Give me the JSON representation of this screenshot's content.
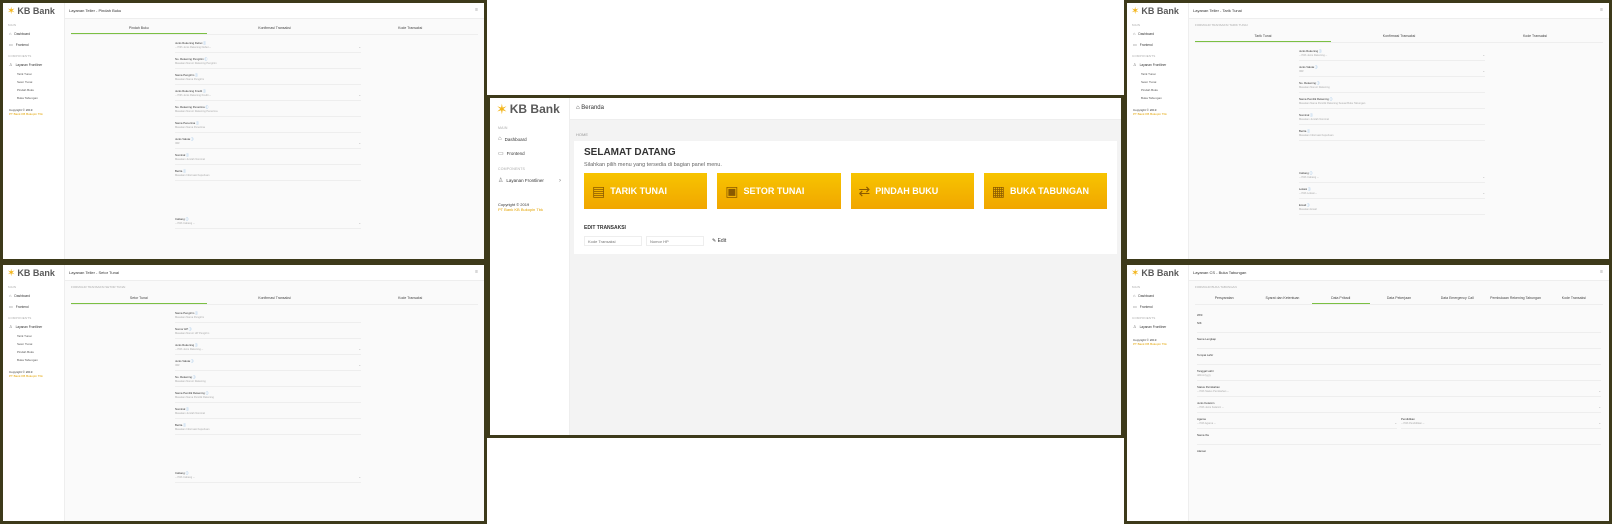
{
  "brand": "KB Bank",
  "sidebar": {
    "main_label": "MAIN",
    "dashboard": "Dashboard",
    "frontend": "Frontend",
    "components_label": "COMPONENTS",
    "layanan": "Layanan Frontliner",
    "sub_tarik": "Tarik Tunai",
    "sub_setor": "Setor Tunai",
    "sub_pindah": "Pindah Buku",
    "sub_buka": "Buka Tabungan",
    "copyright": "Copyright © 2019",
    "company": "PT Bank KB Bukopin Tbk"
  },
  "main": {
    "topbar": "Beranda",
    "crumb": "HOME",
    "welcome_title": "SELAMAT DATANG",
    "welcome_sub": "Silahkan pilih menu yang tersedia di bagian panel menu.",
    "menu": [
      "TARIK TUNAI",
      "SETOR TUNAI",
      "PINDAH BUKU",
      "BUKA TABUNGAN"
    ],
    "edit_title": "EDIT TRANSAKSI",
    "kode_placeholder": "Kode Transaksi",
    "nomor_placeholder": "Nomor HP",
    "edit_btn": "Edit"
  },
  "pindah": {
    "title": "Layanan Teller - Pindah Buku",
    "tabs": [
      "Pindah Buku",
      "Konfirmasi Transaksi",
      "Kode Transaksi"
    ],
    "fields": [
      {
        "label": "Jenis Rekening Debet",
        "ph": "-- PIlih Jenis Rekening Debet --",
        "dd": true
      },
      {
        "label": "No. Rekening Pengirim",
        "ph": "Masukan Nomor Rekening Pengirim"
      },
      {
        "label": "Nama Pengirim",
        "ph": "Masukan Nama Pengirim"
      },
      {
        "label": "Jenis Rekening Kredit",
        "ph": "-- PIlih Jenis Rekening Kredit --",
        "dd": true
      },
      {
        "label": "No. Rekening Penerima",
        "ph": "Masukan Nomor Rekening Penerima"
      },
      {
        "label": "Nama Penerima",
        "ph": "Masukan Nama Penerima"
      },
      {
        "label": "Jenis Valuta",
        "ph": "IDR",
        "dd": true
      },
      {
        "label": "Nominal",
        "ph": "Masukan Jumlah Nominal"
      },
      {
        "label": "Berita",
        "ph": "Masukan Informasi Keperluan"
      }
    ],
    "cabang_label": "Cabang",
    "cabang_ph": "-- Pilih Cabang --"
  },
  "setor": {
    "title": "Layanan Teller - Setor Tunai",
    "panel": "FORMULIR TRANSAKSI SETOR TUNAI",
    "tabs": [
      "Setor Tunai",
      "Konfirmasi Transaksi",
      "Kode Transaksi"
    ],
    "fields": [
      {
        "label": "Nama Pengirim",
        "ph": "Masukan Nama Pengirim"
      },
      {
        "label": "Nomor HP",
        "ph": "Masukan Nomor HP Pengirim"
      },
      {
        "label": "Jenis Rekening",
        "ph": "-- Pilih Jenis Rekening --",
        "dd": true
      },
      {
        "label": "Jenis Valuta",
        "ph": "IDR",
        "dd": true
      },
      {
        "label": "No. Rekening",
        "ph": "Masukan Nomor Rekening"
      },
      {
        "label": "Nama Pemilik Rekening",
        "ph": "Masukan Nama Pemilik Rekening"
      },
      {
        "label": "Nominal",
        "ph": "Masukan Jumlah Nominal"
      },
      {
        "label": "Berita",
        "ph": "Masukan Informasi Keperluan"
      }
    ],
    "cabang_label": "Cabang",
    "cabang_ph": "-- Pilih Cabang --"
  },
  "tarik": {
    "title": "Layanan Teller - Tarik Tunai",
    "panel": "FORMULIR TRANSAKSI TARIK TUNAI",
    "tabs": [
      "Tarik Tunai",
      "Konfirmasi Transaksi",
      "Kode Transaksi"
    ],
    "fields": [
      {
        "label": "Jenis Rekening",
        "ph": "-- Pilih Jenis Rekening --",
        "dd": true
      },
      {
        "label": "Jenis Valuta",
        "ph": "IDR",
        "dd": true
      },
      {
        "label": "No. Rekening",
        "ph": "Masukan Nomor Rekening"
      },
      {
        "label": "Nama Pemilik Rekening",
        "ph": "Masukan Nama Pemilik Rekening Sesuai Buku Tabungan"
      },
      {
        "label": "Nominal",
        "ph": "Masukan Jumlah Nominal"
      },
      {
        "label": "Berita",
        "ph": "Masukan Informasi Keperluan"
      }
    ],
    "extra": [
      {
        "label": "Cabang",
        "ph": "-- Pilih Cabang --",
        "dd": true
      },
      {
        "label": "Lokasi",
        "ph": "-- Pilih Lokasi --",
        "dd": true
      },
      {
        "label": "Email",
        "ph": "Masukan Email"
      }
    ]
  },
  "buka": {
    "title": "Layanan CS - Buka Tabungan",
    "panel": "FORMULIR BUKA TABUNGAN",
    "tabs": [
      "Persyaratan",
      "Syarat dan Ketentuan",
      "Data Pribadi",
      "Data Pekerjaan",
      "Data Emergency Call",
      "Pembukaan Rekening Tabungan",
      "Kode Transaksi"
    ],
    "section": "WNI",
    "fields": [
      {
        "label": "NIK",
        "ph": ""
      },
      {
        "label": "Nama Lengkap",
        "ph": ""
      },
      {
        "label": "Tempat Lahir",
        "ph": ""
      },
      {
        "label": "Tanggal Lahir",
        "ph": "dd/mm/yyyy"
      },
      {
        "label": "Status Pernikahan",
        "ph": "-- Pilih Status Pernikahan --",
        "dd": true
      },
      {
        "label": "Jenis Kelamin",
        "ph": "-- Pilih Jenis Kelamin --",
        "dd": true
      }
    ],
    "agama_label": "Agama",
    "agama_ph": "-- Pilih Agama --",
    "pendidikan_label": "Pendidikan",
    "pendidikan_ph": "-- Pilih Pendidikan --",
    "ibu_label": "Nama Ibu",
    "alamat_label": "Alamat"
  }
}
